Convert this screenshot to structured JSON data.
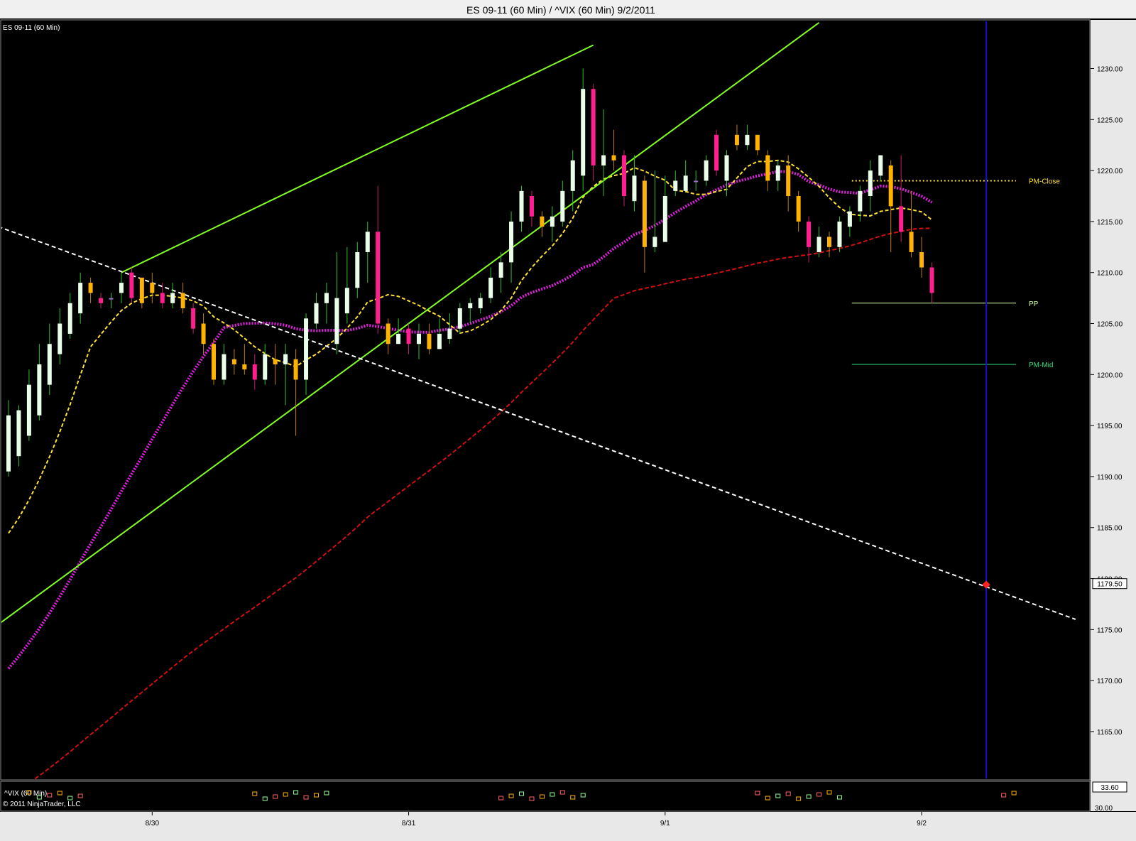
{
  "window": {
    "title": "ES 09-11 (60 Min) / ^VIX (60 Min)  9/2/2011"
  },
  "panels": {
    "price_label": "ES 09-11 (60 Min)",
    "vix_label": "^VIX (60 Min)",
    "copyright": "© 2011 NinjaTrader, LLC"
  },
  "colors": {
    "background": "#000000",
    "up_candle": "#eaffea",
    "down_orange": "#ffb300",
    "down_magenta": "#ff1f8f",
    "doji": "#a070d0",
    "sma_fast": "#ffe135",
    "sma_mid": "#e020e0",
    "sma_slow": "#d01010",
    "trendline": "#80ff20",
    "white_trend": "#ffffff",
    "cursor": "#1010d0",
    "pm_close": "#ffe135",
    "pp": "#d8ffa0",
    "pm_mid": "#30e080"
  },
  "chart_data": {
    "type": "candlestick",
    "y_axis_ticks": [
      "1230.00",
      "1225.00",
      "1220.00",
      "1215.00",
      "1210.00",
      "1205.00",
      "1200.00",
      "1195.00",
      "1190.00",
      "1185.00",
      "1180.00",
      "1175.00",
      "1170.00",
      "1165.00"
    ],
    "ylim": [
      1160.4,
      1234.7
    ],
    "last_price": "1179.50",
    "x_ticks": [
      {
        "label": "8/30",
        "bar": 14
      },
      {
        "label": "8/31",
        "bar": 39
      },
      {
        "label": "9/1",
        "bar": 64
      },
      {
        "label": "9/2",
        "bar": 89
      }
    ],
    "candles": [
      [
        1190.5,
        1196,
        1197.5,
        1190
      ],
      [
        1192,
        1196.5,
        1197,
        1191
      ],
      [
        1194,
        1199,
        1200.5,
        1193.5
      ],
      [
        1196,
        1201,
        1203,
        1195.5
      ],
      [
        1199,
        1203,
        1205,
        1198
      ],
      [
        1202,
        1205,
        1206.5,
        1201
      ],
      [
        1204,
        1207,
        1208,
        1203.5
      ],
      [
        1206,
        1209,
        1210,
        1205
      ],
      [
        1209,
        1208,
        1209.5,
        1207
      ],
      [
        1207.5,
        1207,
        1208,
        1206.5
      ],
      [
        1207.5,
        1207.5,
        1208,
        1206.5
      ],
      [
        1208,
        1209,
        1210,
        1207
      ],
      [
        1210,
        1207.5,
        1210.5,
        1207
      ],
      [
        1209.5,
        1207,
        1209.5,
        1206.5
      ],
      [
        1209,
        1208,
        1210,
        1207
      ],
      [
        1208,
        1207,
        1209,
        1206.5
      ],
      [
        1207,
        1208,
        1209,
        1206.5
      ],
      [
        1208,
        1206.5,
        1209,
        1206
      ],
      [
        1206.5,
        1204.5,
        1207,
        1204
      ],
      [
        1205,
        1203,
        1206,
        1202
      ],
      [
        1203,
        1199.5,
        1203.5,
        1199
      ],
      [
        1199.5,
        1202,
        1203,
        1199
      ],
      [
        1201.5,
        1201,
        1202.5,
        1200
      ],
      [
        1201,
        1200.5,
        1203,
        1200
      ],
      [
        1201,
        1199.5,
        1202,
        1198.5
      ],
      [
        1199.5,
        1202,
        1203,
        1199
      ],
      [
        1201.5,
        1201,
        1203,
        1199
      ],
      [
        1201,
        1202,
        1203,
        1197
      ],
      [
        1201.5,
        1199.5,
        1202.5,
        1194
      ],
      [
        1199.5,
        1205.5,
        1206,
        1198
      ],
      [
        1205,
        1207,
        1208,
        1204.5
      ],
      [
        1207,
        1208,
        1209,
        1205
      ],
      [
        1203,
        1207.5,
        1212,
        1202
      ],
      [
        1206,
        1208.5,
        1212.5,
        1205
      ],
      [
        1208.5,
        1212,
        1213,
        1207.5
      ],
      [
        1212,
        1214,
        1215,
        1209
      ],
      [
        1214,
        1205,
        1218.5,
        1204
      ],
      [
        1205,
        1203,
        1205.5,
        1202
      ],
      [
        1203,
        1204,
        1205.5,
        1203
      ],
      [
        1204.5,
        1203,
        1205,
        1202
      ],
      [
        1203,
        1204,
        1205,
        1201.5
      ],
      [
        1204,
        1202.5,
        1205,
        1202
      ],
      [
        1202.5,
        1204,
        1205.5,
        1203
      ],
      [
        1203.5,
        1204.5,
        1206,
        1203
      ],
      [
        1204.5,
        1206.5,
        1207,
        1204
      ],
      [
        1206.5,
        1207,
        1207.5,
        1205
      ],
      [
        1206.5,
        1207.5,
        1208,
        1206
      ],
      [
        1207.5,
        1209.5,
        1210.5,
        1207
      ],
      [
        1209.5,
        1211,
        1212,
        1208
      ],
      [
        1211,
        1215,
        1216,
        1209
      ],
      [
        1215,
        1218,
        1218.5,
        1214
      ],
      [
        1217.5,
        1215.5,
        1218,
        1214.5
      ],
      [
        1215.5,
        1214.5,
        1216,
        1213.5
      ],
      [
        1214.5,
        1215.5,
        1216.5,
        1213
      ],
      [
        1215,
        1218,
        1219,
        1214.5
      ],
      [
        1218,
        1221,
        1222,
        1216
      ],
      [
        1219.5,
        1228,
        1230,
        1218
      ],
      [
        1228,
        1220.5,
        1228.5,
        1219
      ],
      [
        1220.5,
        1221.5,
        1226,
        1217.5
      ],
      [
        1221.5,
        1221,
        1224,
        1220
      ],
      [
        1221.5,
        1217.5,
        1222,
        1216.5
      ],
      [
        1217,
        1219.5,
        1221.5,
        1216
      ],
      [
        1219,
        1212.5,
        1219.5,
        1210
      ],
      [
        1212.5,
        1213.5,
        1220,
        1212
      ],
      [
        1213,
        1217.5,
        1219.5,
        1213
      ],
      [
        1218,
        1219,
        1220,
        1217.5
      ],
      [
        1218,
        1219.5,
        1221,
        1218
      ],
      [
        1219,
        1219,
        1220,
        1218
      ],
      [
        1219,
        1221,
        1221.5,
        1218.5
      ],
      [
        1223.5,
        1220,
        1224,
        1219.5
      ],
      [
        1219,
        1221.5,
        1222,
        1217.5
      ],
      [
        1223.5,
        1222.5,
        1224.5,
        1222
      ],
      [
        1222.5,
        1223.5,
        1224.5,
        1222
      ],
      [
        1223.5,
        1222,
        1223.5,
        1221.5
      ],
      [
        1221.5,
        1219,
        1222,
        1218
      ],
      [
        1219,
        1220.5,
        1221,
        1218
      ],
      [
        1220.5,
        1217.5,
        1221.5,
        1216
      ],
      [
        1217.5,
        1215,
        1218,
        1214
      ],
      [
        1215,
        1212.5,
        1215.5,
        1211
      ],
      [
        1212,
        1213.5,
        1214.5,
        1211.5
      ],
      [
        1213.5,
        1212.5,
        1214,
        1211.5
      ],
      [
        1212.5,
        1215,
        1215.5,
        1212
      ],
      [
        1214.5,
        1216,
        1216.5,
        1213.5
      ],
      [
        1216,
        1218,
        1218.5,
        1215
      ],
      [
        1217.5,
        1220,
        1221,
        1216
      ],
      [
        1219.5,
        1221.5,
        1221.5,
        1219
      ],
      [
        1220.5,
        1216.5,
        1221,
        1212
      ],
      [
        1216.5,
        1214,
        1221.5,
        1213
      ],
      [
        1214,
        1212,
        1218,
        1211.5
      ],
      [
        1212,
        1210.5,
        1213.5,
        1209.5
      ],
      [
        1210.5,
        1208,
        1211,
        1207
      ]
    ]
  }
}
